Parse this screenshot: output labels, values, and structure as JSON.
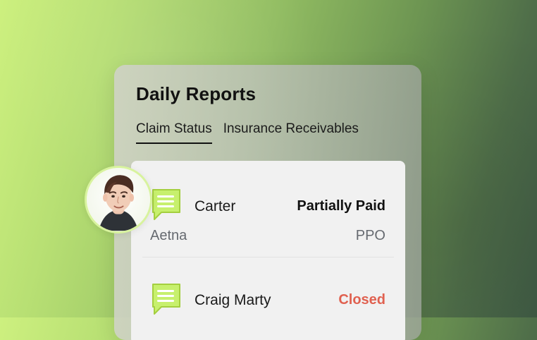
{
  "panel": {
    "title": "Daily Reports"
  },
  "tabs": [
    {
      "label": "Claim Status",
      "active": true
    },
    {
      "label": "Insurance Receivables",
      "active": false
    }
  ],
  "claims": [
    {
      "name": "Carter",
      "status": "Partially Paid",
      "payer": "Aetna",
      "plan": "PPO",
      "icon": "message-icon"
    },
    {
      "name": "Craig Marty",
      "status": "Closed",
      "payer": "",
      "plan": "",
      "icon": "message-icon"
    }
  ],
  "avatar": {
    "icon": "avatar"
  },
  "colors": {
    "accent_green": "#c6ee74",
    "status_closed": "#e06150"
  }
}
